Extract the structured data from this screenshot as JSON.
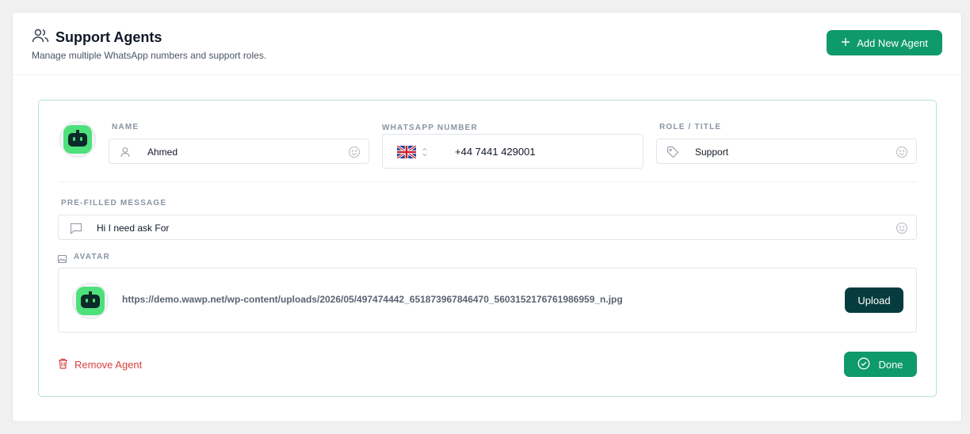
{
  "header": {
    "title": "Support Agents",
    "subtitle": "Manage multiple WhatsApp numbers and support roles.",
    "add_button": "Add New Agent"
  },
  "agent": {
    "name_label": "NAME",
    "name_value": "Ahmed",
    "whatsapp_label": "WHATSAPP NUMBER",
    "phone_value": "+44 7441 429001",
    "role_label": "ROLE / TITLE",
    "role_value": "Support",
    "message_label": "PRE-FILLED MESSAGE",
    "message_value": "Hi I need ask For",
    "avatar_label": "AVATAR",
    "avatar_url": "https://demo.wawp.net/wp-content/uploads/2026/05/497474442_651873967846470_5603152176761986959_n.jpg",
    "upload_button": "Upload",
    "remove_button": "Remove Agent",
    "done_button": "Done"
  },
  "colors": {
    "primary": "#0f9a6c",
    "dark": "#063c3d",
    "danger": "#d94141",
    "card_border": "#b9e3cf"
  }
}
